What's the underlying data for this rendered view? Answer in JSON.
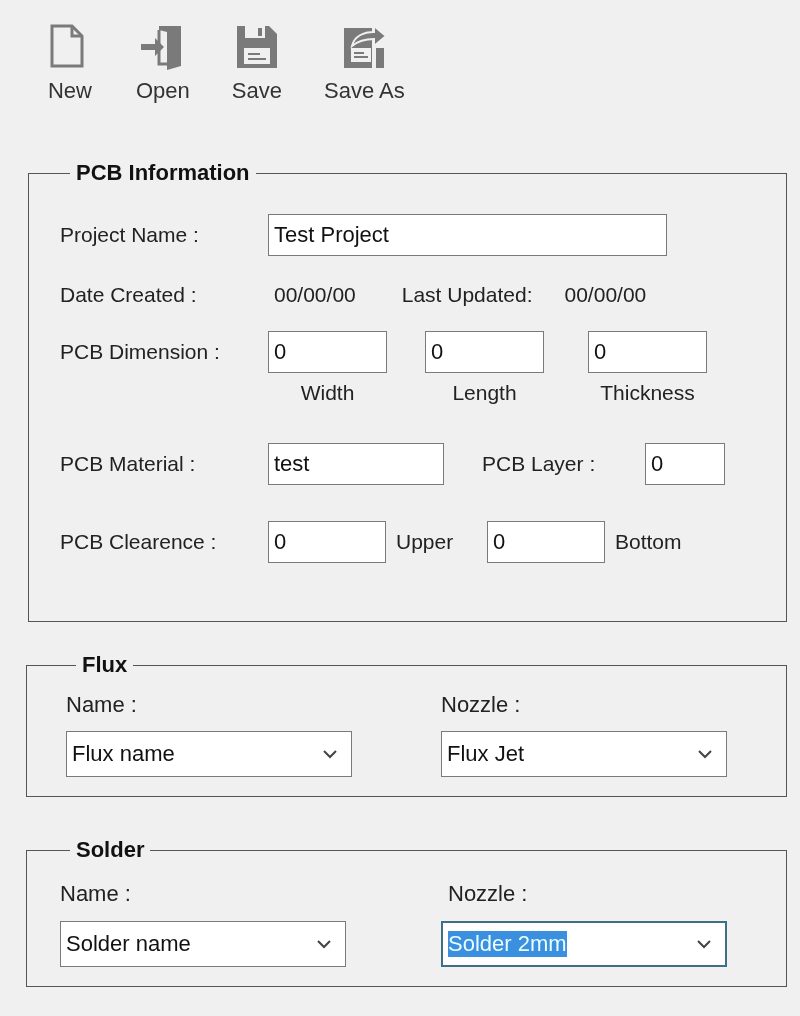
{
  "toolbar": [
    {
      "kind": "new",
      "label": "New"
    },
    {
      "kind": "open",
      "label": "Open"
    },
    {
      "kind": "save",
      "label": "Save"
    },
    {
      "kind": "save_as",
      "label": "Save As"
    }
  ],
  "pcb_information": {
    "title": "PCB Information",
    "project_name": {
      "label": "Project Name :",
      "value": "Test Project"
    },
    "date_created": {
      "label": "Date Created :",
      "value": "00/00/00"
    },
    "last_updated": {
      "label": "Last Updated:",
      "value": "00/00/00"
    },
    "dimension": {
      "label": "PCB Dimension :",
      "fields": [
        {
          "value": "0",
          "caption": "Width"
        },
        {
          "value": "0",
          "caption": "Length"
        },
        {
          "value": "0",
          "caption": "Thickness"
        }
      ]
    },
    "material": {
      "label": "PCB Material :",
      "value": "test"
    },
    "layer": {
      "label": "PCB Layer :",
      "value": "0"
    },
    "clearance": {
      "label": "PCB Clearence :",
      "fields": [
        {
          "value": "0",
          "caption": "Upper"
        },
        {
          "value": "0",
          "caption": "Bottom"
        }
      ]
    }
  },
  "flux": {
    "title": "Flux",
    "name": {
      "label": "Name :",
      "value": "Flux name",
      "focused": false
    },
    "nozzle": {
      "label": "Nozzle :",
      "value": "Flux Jet",
      "focused": false
    }
  },
  "solder": {
    "title": "Solder",
    "name": {
      "label": "Name :",
      "value": "Solder name",
      "focused": false
    },
    "nozzle": {
      "label": "Nozzle :",
      "value": "Solder 2mm",
      "focused": true
    }
  }
}
